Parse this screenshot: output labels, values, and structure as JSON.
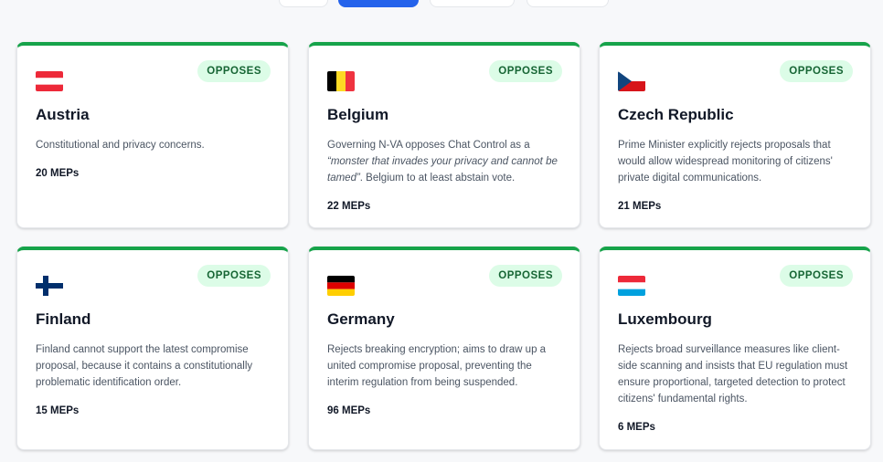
{
  "tabs": [
    {
      "label": ""
    },
    {
      "label": ""
    },
    {
      "label": ""
    },
    {
      "label": ""
    }
  ],
  "status_color": "#16a34a",
  "cards": [
    {
      "country": "Austria",
      "status": "OPPOSES",
      "flag": "austria-flag-icon",
      "desc": "Constitutional and privacy concerns.",
      "meps": "20 MEPs"
    },
    {
      "country": "Belgium",
      "status": "OPPOSES",
      "flag": "belgium-flag-icon",
      "desc_pre": "Governing N-VA opposes Chat Control as a ",
      "desc_quote": "“monster that invades your privacy and cannot be tamed”",
      "desc_post": ". Belgium to at least abstain vote.",
      "meps": "22 MEPs"
    },
    {
      "country": "Czech Republic",
      "status": "OPPOSES",
      "flag": "czech-flag-icon",
      "desc": "Prime Minister explicitly rejects proposals that would allow widespread monitoring of citizens' private digital communications.",
      "meps": "21 MEPs"
    },
    {
      "country": "Finland",
      "status": "OPPOSES",
      "flag": "finland-flag-icon",
      "desc": "Finland cannot support the latest compromise proposal, because it contains a constitutionally problematic identification order.",
      "meps": "15 MEPs"
    },
    {
      "country": "Germany",
      "status": "OPPOSES",
      "flag": "germany-flag-icon",
      "desc": "Rejects breaking encryption; aims to draw up a united compromise proposal, preventing the interim regulation from being suspended.",
      "meps": "96 MEPs"
    },
    {
      "country": "Luxembourg",
      "status": "OPPOSES",
      "flag": "luxembourg-flag-icon",
      "desc": "Rejects broad surveillance measures like client-side scanning and insists that EU regulation must ensure proportional, targeted detection to protect citizens' fundamental rights.",
      "meps": "6 MEPs"
    }
  ]
}
